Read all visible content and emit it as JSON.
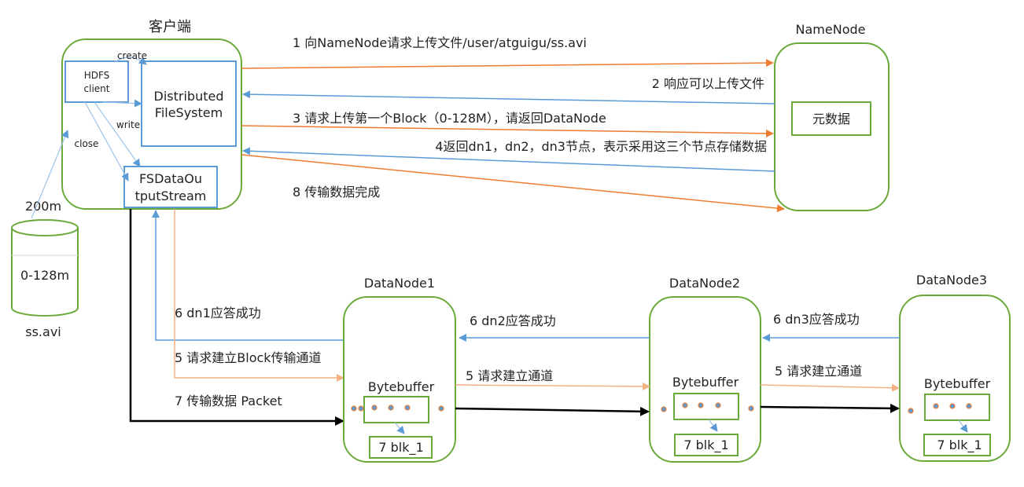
{
  "client": {
    "title": "客户端",
    "hdfs_client": [
      "HDFS",
      "client"
    ],
    "dfs": [
      "Distributed",
      "FileSystem"
    ],
    "fsdos": [
      "FSDataOu",
      "tputStream"
    ],
    "create": "create",
    "write": "write",
    "close": "close"
  },
  "file": {
    "size": "200m",
    "block": "0-128m",
    "name": "ss.avi"
  },
  "namenode": {
    "title": "NameNode",
    "metadata": "元数据"
  },
  "steps": {
    "s1": "1 向NameNode请求上传文件/user/atguigu/ss.avi",
    "s2": "2 响应可以上传文件",
    "s3": "3 请求上传第一个Block（0-128M），请返回DataNode",
    "s4": "4返回dn1，dn2，dn3节点，表示采用这三个节点存储数据",
    "s8": "8 传输数据完成",
    "s6_dn1": "6 dn1应答成功",
    "s5_client": "5 请求建立Block传输通道",
    "s7": "7 传输数据  Packet",
    "s6_dn2": "6 dn2应答成功",
    "s5_dn1": "5 请求建立通道",
    "s6_dn3": "6 dn3应答成功",
    "s5_dn2": "5 请求建立通道"
  },
  "datanodes": [
    {
      "title": "DataNode1",
      "buffer": "Bytebuffer",
      "block": "7 blk_1"
    },
    {
      "title": "DataNode2",
      "buffer": "Bytebuffer",
      "block": "7 blk_1"
    },
    {
      "title": "DataNode3",
      "buffer": "Bytebuffer",
      "block": "7 blk_1"
    }
  ],
  "colors": {
    "node_border": "#6aaa3a",
    "inner_blue": "#5b9bd5",
    "arrow_orange": "#ed7d31",
    "arrow_light_orange": "#f4b183",
    "arrow_blue": "#5b9bd5",
    "data_flow": "#000000"
  }
}
